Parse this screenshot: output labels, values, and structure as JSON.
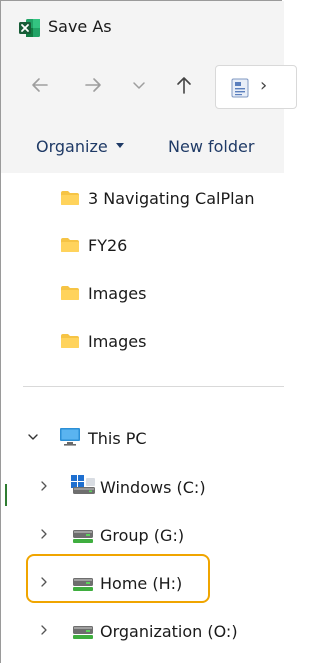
{
  "window": {
    "title": "Save As",
    "app_icon": "excel-icon",
    "accent": "#1e7145"
  },
  "navigation": {
    "back_icon": "arrow-left-icon",
    "forward_icon": "arrow-right-icon",
    "recent_icon": "chevron-down-icon",
    "up_icon": "arrow-up-icon",
    "address_icon": "document-icon",
    "address_chevron": "›"
  },
  "toolbar": {
    "organize_label": "Organize",
    "new_folder_label": "New folder"
  },
  "folders": [
    {
      "label": "3 Navigating CalPlan"
    },
    {
      "label": "FY26"
    },
    {
      "label": "Images"
    },
    {
      "label": "Images"
    }
  ],
  "this_pc": {
    "label": "This PC",
    "expanded": true,
    "drives": [
      {
        "label": "Windows (C:)",
        "icon": "windows-drive-icon"
      },
      {
        "label": "Group (G:)",
        "icon": "network-drive-icon"
      },
      {
        "label": "Home (H:)",
        "icon": "network-drive-icon",
        "highlighted": true
      },
      {
        "label": "Organization (O:)",
        "icon": "network-drive-icon"
      }
    ]
  },
  "colors": {
    "folder": "#f6c445",
    "highlight_border": "#f0a500",
    "toolbar_text": "#1f3a66",
    "chrome_bg": "#f4f4f4"
  }
}
